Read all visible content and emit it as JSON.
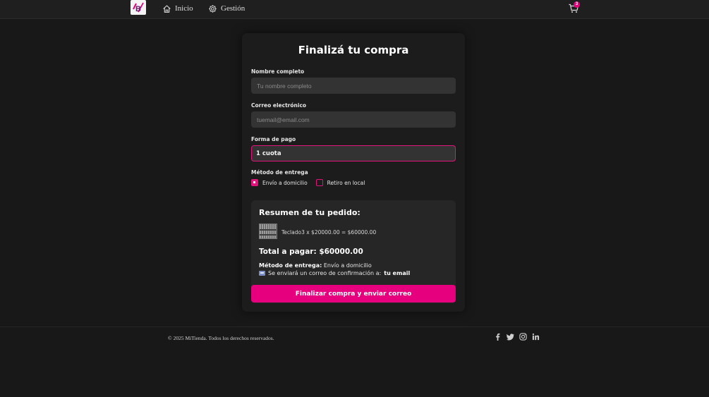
{
  "navbar": {
    "logo_text": "B",
    "links": [
      {
        "label": "Inicio",
        "icon": "home-icon"
      },
      {
        "label": "Gestión",
        "icon": "gear-icon"
      }
    ],
    "cart_count": "3"
  },
  "checkout": {
    "title": "Finalizá tu compra",
    "name": {
      "label": "Nombre completo",
      "placeholder": "Tu nombre completo",
      "value": ""
    },
    "email": {
      "label": "Correo electrónico",
      "placeholder": "tuemail@email.com",
      "value": ""
    },
    "payment": {
      "label": "Forma de pago",
      "selected": "1 cuota"
    },
    "delivery": {
      "label": "Método de entrega",
      "options": [
        {
          "label": "Envío a domicilio",
          "checked": true
        },
        {
          "label": "Retiro en local",
          "checked": false
        }
      ]
    },
    "summary": {
      "title": "Resumen de tu pedido:",
      "items": [
        {
          "text": "Teclado3 x $20000.00 = $60000.00"
        }
      ],
      "total": "Total a pagar: $60000.00",
      "delivery_label": "Método de entrega:",
      "delivery_value": "Envío a domicilio",
      "confirm_text": "Se enviará un correo de confirmación a:",
      "confirm_email": "tu email"
    },
    "submit_label": "Finalizar compra y enviar correo"
  },
  "footer": {
    "copyright": "© 2025 MiTienda. Todos los derechos reservados.",
    "social": [
      "facebook-icon",
      "twitter-icon",
      "instagram-icon",
      "linkedin-icon"
    ]
  },
  "colors": {
    "accent": "#e6007e",
    "background": "#181818",
    "card": "#1c1c1c",
    "input": "#333333"
  }
}
